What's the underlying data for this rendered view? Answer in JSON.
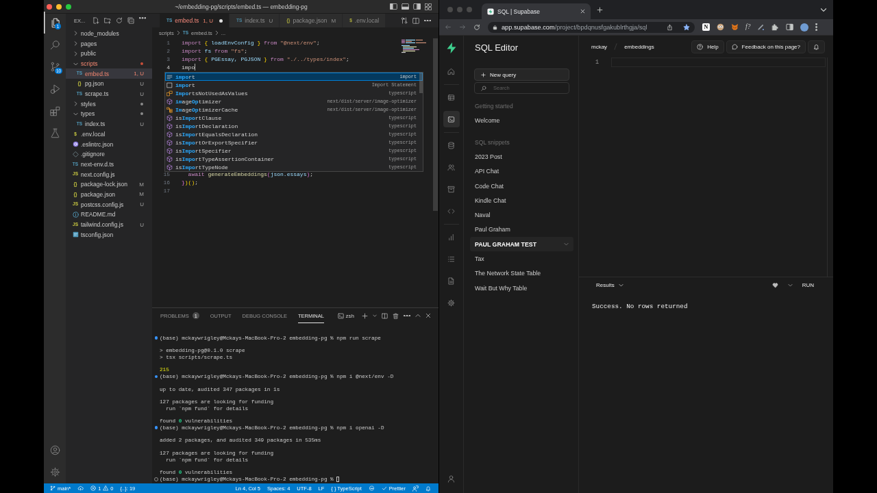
{
  "vscode": {
    "title": "~/embedding-pg/scripts/embed.ts — embedding-pg",
    "activity": [
      {
        "kind": "explorer",
        "selected": true,
        "badge": "1"
      },
      {
        "kind": "search",
        "selected": false
      },
      {
        "kind": "source-control",
        "selected": false,
        "badge": "10"
      },
      {
        "kind": "run-debug",
        "selected": false
      },
      {
        "kind": "extensions",
        "selected": false
      },
      {
        "kind": "testing",
        "selected": false
      }
    ],
    "activity_bottom": [
      {
        "kind": "account"
      },
      {
        "kind": "settings"
      }
    ],
    "explorer": {
      "title": "EX...",
      "tree": [
        {
          "name": "node_modules",
          "kind": "folder",
          "expanded": false,
          "dot": false,
          "selected": false,
          "error": false
        },
        {
          "name": "pages",
          "kind": "folder",
          "expanded": false,
          "dot": false,
          "selected": false,
          "error": false
        },
        {
          "name": "public",
          "kind": "folder",
          "expanded": false,
          "dot": false,
          "selected": false,
          "error": false
        },
        {
          "name": "scripts",
          "kind": "folder",
          "expanded": true,
          "dot": true,
          "selected": false,
          "error": true,
          "children": [
            {
              "name": "embed.ts",
              "kind": "ts",
              "glyph": "TS",
              "decoration": "1, U",
              "selected": true,
              "error": true
            },
            {
              "name": "pg.json",
              "kind": "json",
              "glyph": "{}",
              "decoration": "U",
              "selected": false,
              "error": false
            },
            {
              "name": "scrape.ts",
              "kind": "ts",
              "glyph": "TS",
              "decoration": "U",
              "selected": false,
              "error": false
            }
          ]
        },
        {
          "name": "styles",
          "kind": "folder",
          "expanded": false,
          "dot": true,
          "selected": false,
          "error": false
        },
        {
          "name": "types",
          "kind": "folder",
          "expanded": true,
          "dot": true,
          "selected": false,
          "error": false,
          "children": [
            {
              "name": "index.ts",
              "kind": "ts",
              "glyph": "TS",
              "decoration": "U",
              "selected": false,
              "error": false
            }
          ]
        },
        {
          "name": ".env.local",
          "kind": "env",
          "glyph": "$",
          "selected": false,
          "error": false
        },
        {
          "name": ".eslintrc.json",
          "kind": "eslint",
          "selected": false,
          "error": false
        },
        {
          "name": ".gitignore",
          "kind": "git",
          "selected": false,
          "error": false
        },
        {
          "name": "next-env.d.ts",
          "kind": "ts",
          "glyph": "TS",
          "selected": false,
          "error": false
        },
        {
          "name": "next.config.js",
          "kind": "js",
          "glyph": "JS",
          "selected": false,
          "error": false
        },
        {
          "name": "package-lock.json",
          "kind": "json",
          "glyph": "{}",
          "decoration": "M",
          "selected": false,
          "error": false
        },
        {
          "name": "package.json",
          "kind": "json",
          "glyph": "{}",
          "decoration": "M",
          "selected": false,
          "error": false
        },
        {
          "name": "postcss.config.js",
          "kind": "js",
          "glyph": "JS",
          "decoration": "U",
          "selected": false,
          "error": false
        },
        {
          "name": "README.md",
          "kind": "info",
          "selected": false,
          "error": false
        },
        {
          "name": "tailwind.config.js",
          "kind": "js",
          "glyph": "JS",
          "decoration": "U",
          "selected": false,
          "error": false
        },
        {
          "name": "tsconfig.json",
          "kind": "tsconfig",
          "selected": false,
          "error": false
        }
      ]
    },
    "tabs": [
      {
        "kind": "ts",
        "glyph": "TS",
        "label": "embed.ts",
        "decoration": "1, U",
        "selected": true,
        "modified": true,
        "error": true
      },
      {
        "kind": "ts",
        "glyph": "TS",
        "label": "index.ts",
        "decoration": "U",
        "selected": false,
        "modified": false,
        "error": false
      },
      {
        "kind": "json",
        "glyph": "{}",
        "label": "package.json",
        "decoration": "M",
        "selected": false,
        "modified": false,
        "error": false
      },
      {
        "kind": "env",
        "glyph": "$",
        "label": ".env.local",
        "selected": false,
        "modified": false,
        "error": false
      }
    ],
    "breadcrumb": {
      "path": [
        "scripts"
      ],
      "file": {
        "kind": "ts",
        "glyph": "TS",
        "label": "embed.ts"
      },
      "tail": "..."
    },
    "code": [
      {
        "number": "1",
        "cursor": false,
        "tokens": [
          {
            "kind": "keyword",
            "text": "import "
          },
          {
            "kind": "bracket",
            "text": "{"
          },
          {
            "kind": "variable",
            "text": " loadEnvConfig "
          },
          {
            "kind": "bracket",
            "text": "}"
          },
          {
            "kind": "keyword",
            "text": " from "
          },
          {
            "kind": "string",
            "text": "\"@next/env\""
          },
          {
            "kind": "punctuation",
            "text": ";"
          }
        ]
      },
      {
        "number": "2",
        "cursor": false,
        "tokens": [
          {
            "kind": "keyword",
            "text": "import "
          },
          {
            "kind": "variable",
            "text": "fs"
          },
          {
            "kind": "keyword",
            "text": " from "
          },
          {
            "kind": "string",
            "text": "\"fs\""
          },
          {
            "kind": "punctuation",
            "text": ";"
          }
        ]
      },
      {
        "number": "3",
        "cursor": false,
        "tokens": [
          {
            "kind": "keyword",
            "text": "import "
          },
          {
            "kind": "bracket",
            "text": "{"
          },
          {
            "kind": "variable",
            "text": " PGEssay, PGJSON "
          },
          {
            "kind": "bracket",
            "text": "}"
          },
          {
            "kind": "keyword",
            "text": " from "
          },
          {
            "kind": "string",
            "text": "\"./../types/index\""
          },
          {
            "kind": "punctuation",
            "text": ";"
          }
        ]
      },
      {
        "number": "4",
        "cursor": true,
        "tokens": [
          {
            "kind": "plain",
            "text": "impo"
          }
        ]
      },
      {
        "number": "15",
        "cursor": false,
        "tokens": [
          {
            "kind": "keyword",
            "text": "  await "
          },
          {
            "kind": "function",
            "text": "generateEmbeddings"
          },
          {
            "kind": "paren",
            "text": "("
          },
          {
            "kind": "variable",
            "text": "json.essays"
          },
          {
            "kind": "paren",
            "text": ")"
          },
          {
            "kind": "punctuation",
            "text": ";"
          }
        ]
      },
      {
        "number": "16",
        "cursor": false,
        "tokens": [
          {
            "kind": "paren",
            "text": "}"
          },
          {
            "kind": "bracket",
            "text": ")()"
          },
          {
            "kind": "punctuation",
            "text": ";"
          }
        ]
      },
      {
        "number": "17",
        "cursor": false
      }
    ],
    "suggestions": [
      {
        "kind": "keyword",
        "label": "**impo**rt",
        "detail": "import",
        "selected": true
      },
      {
        "kind": "snippet",
        "label": "**impo**rt",
        "detail": "Import Statement",
        "selected": false
      },
      {
        "kind": "enum",
        "label": "**Impo**rtsNotUsedAsValues",
        "detail": "typescript",
        "selected": false
      },
      {
        "kind": "method",
        "label": "**im**age**Op**timizer",
        "detail": "next/dist/server/image-optimizer",
        "selected": false
      },
      {
        "kind": "class",
        "label": "**Im**age**Op**timizerCache",
        "detail": "next/dist/server/image-optimizer",
        "selected": false
      },
      {
        "kind": "method",
        "label": "is**Impo**rtClause",
        "detail": "typescript",
        "selected": false
      },
      {
        "kind": "method",
        "label": "is**Impo**rtDeclaration",
        "detail": "typescript",
        "selected": false
      },
      {
        "kind": "method",
        "label": "is**Impo**rtEqualsDeclaration",
        "detail": "typescript",
        "selected": false
      },
      {
        "kind": "method",
        "label": "is**Impo**rtOrExportSpecifier",
        "detail": "typescript",
        "selected": false
      },
      {
        "kind": "method",
        "label": "is**Impo**rtSpecifier",
        "detail": "typescript",
        "selected": false
      },
      {
        "kind": "method",
        "label": "is**Impo**rtTypeAssertionContainer",
        "detail": "typescript",
        "selected": false
      },
      {
        "kind": "method",
        "label": "is**Impo**rtTypeNode",
        "detail": "typescript",
        "selected": false
      }
    ],
    "panel": {
      "tabs": [
        {
          "label": "PROBLEMS",
          "badge": "1",
          "selected": false
        },
        {
          "label": "OUTPUT",
          "selected": false
        },
        {
          "label": "DEBUG CONSOLE",
          "selected": false
        },
        {
          "label": "TERMINAL",
          "selected": true
        }
      ],
      "shell": "zsh",
      "commands": [
        {
          "finished": true,
          "cursor": false,
          "prompt": "(base) mckaywrigley@Mckays-MacBook-Pro-2 embedding-pg % npm run scrape",
          "output": [
            {
              "kind": "plain",
              "lines": [
                "> embedding-pg@0.1.0 scrape",
                "> tsx scripts/scrape.ts"
              ]
            },
            {
              "kind": "count",
              "lines": [
                "215"
              ]
            }
          ]
        },
        {
          "finished": true,
          "cursor": false,
          "prompt": "(base) mckaywrigley@Mckays-MacBook-Pro-2 embedding-pg % npm i @next/env -D",
          "output": [
            {
              "kind": "plain",
              "lines": [
                "up to date, audited 347 packages in 1s"
              ]
            },
            {
              "kind": "plain",
              "lines": [
                "127 packages are looking for funding",
                "  run `npm fund` for details"
              ]
            },
            {
              "kind": "plain",
              "lines": [
                "found **0** vulnerabilities"
              ]
            }
          ]
        },
        {
          "finished": true,
          "cursor": false,
          "prompt": "(base) mckaywrigley@Mckays-MacBook-Pro-2 embedding-pg % npm i openai -D",
          "output": [
            {
              "kind": "plain",
              "lines": [
                "added 2 packages, and audited 349 packages in 535ms"
              ]
            },
            {
              "kind": "plain",
              "lines": [
                "127 packages are looking for funding",
                "  run `npm fund` for details"
              ]
            },
            {
              "kind": "plain",
              "lines": [
                "found **0** vulnerabilities"
              ]
            }
          ]
        },
        {
          "finished": false,
          "cursor": true,
          "prompt": "(base) mckaywrigley@Mckays-MacBook-Pro-2 embedding-pg %"
        }
      ]
    },
    "status_bar": {
      "branch": "main*",
      "errors": "1",
      "warnings": "0",
      "outline": "{..}: 19",
      "position": "Ln 4, Col 5",
      "indent": "Spaces: 4",
      "encoding": "UTF-8",
      "eol": "LF",
      "language": "{ } TypeScript",
      "formatter": "Prettier"
    }
  },
  "browser": {
    "tabs": [
      {
        "title": "SQL | Supabase",
        "selected": true
      }
    ],
    "address": {
      "host": "app.supabase.com",
      "path": "/project/bpdqnusfgakublrthgja/sql"
    },
    "bookmarked": true,
    "extensions": [
      {
        "kind": "notion",
        "glyph": "N"
      },
      {
        "kind": "owl"
      },
      {
        "kind": "fox"
      },
      {
        "kind": "formula",
        "glyph": "f?"
      },
      {
        "kind": "pen"
      },
      {
        "kind": "puzzle"
      },
      {
        "kind": "side-panel"
      },
      {
        "kind": "avatar"
      }
    ],
    "supabase": {
      "nav": [
        {
          "items": [
            {
              "kind": "home",
              "selected": false
            }
          ]
        },
        {
          "items": [
            {
              "kind": "table-editor",
              "selected": false
            },
            {
              "kind": "sql-editor",
              "selected": true
            }
          ]
        },
        {
          "items": [
            {
              "kind": "database",
              "selected": false
            },
            {
              "kind": "auth",
              "selected": false
            },
            {
              "kind": "storage",
              "selected": false
            },
            {
              "kind": "edge-functions",
              "selected": false
            }
          ]
        },
        {
          "items": [
            {
              "kind": "reports",
              "selected": false
            },
            {
              "kind": "logs",
              "selected": false
            },
            {
              "kind": "docs",
              "selected": false
            },
            {
              "kind": "settings",
              "selected": false
            }
          ]
        }
      ],
      "nav_bottom": [
        {
          "kind": "profile"
        }
      ],
      "title": "SQL Editor",
      "new_query": "New query",
      "search": {
        "placeholder": "Search"
      },
      "sections": [
        {
          "title": "Getting started",
          "items": [
            {
              "label": "Welcome",
              "selected": false
            }
          ]
        },
        {
          "title": "SQL snippets",
          "items": [
            {
              "label": "2023 Post",
              "selected": false
            },
            {
              "label": "API Chat",
              "selected": false
            },
            {
              "label": "Code Chat",
              "selected": false
            },
            {
              "label": "Kindle Chat",
              "selected": false
            },
            {
              "label": "Naval",
              "selected": false
            },
            {
              "label": "Paul Graham",
              "selected": false
            },
            {
              "label": "PAUL GRAHAM TEST",
              "selected": true
            },
            {
              "label": "Tax",
              "selected": false
            },
            {
              "label": "The Network State Table",
              "selected": false
            },
            {
              "label": "Wait But Why Table",
              "selected": false
            }
          ]
        }
      ],
      "breadcrumb": [
        "mckay",
        "embeddings"
      ],
      "help": "Help",
      "feedback": "Feedback on this page?",
      "editor": {
        "line_numbers": [
          "1"
        ]
      },
      "results": {
        "title": "Results",
        "run": "RUN",
        "message": "Success. No rows returned"
      }
    }
  }
}
